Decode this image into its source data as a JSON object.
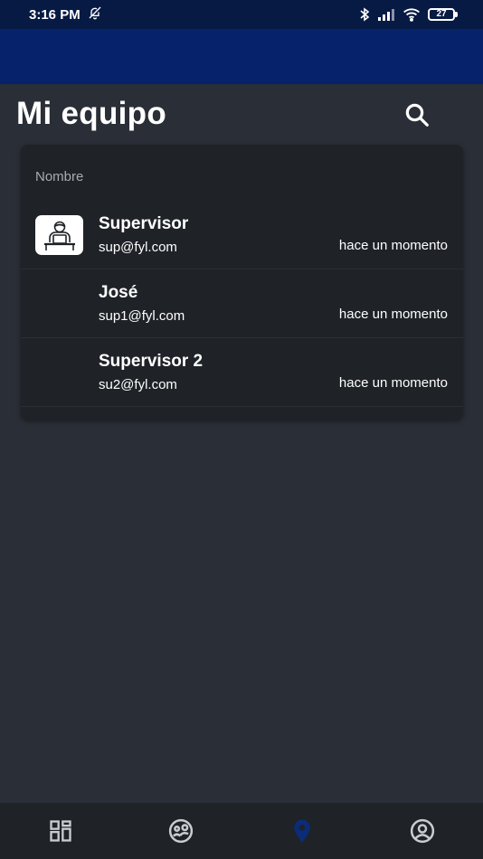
{
  "status_bar": {
    "time": "3:16 PM",
    "battery": "27"
  },
  "header": {
    "title": "Mi equipo"
  },
  "table": {
    "column_name": "Nombre",
    "rows": [
      {
        "name": "Supervisor",
        "email": "sup@fyl.com",
        "time": "hace un momento",
        "has_avatar": true
      },
      {
        "name": "José",
        "email": "sup1@fyl.com",
        "time": "hace un momento",
        "has_avatar": false
      },
      {
        "name": "Supervisor 2",
        "email": "su2@fyl.com",
        "time": "hace un momento",
        "has_avatar": false
      }
    ]
  },
  "bottom_nav": {
    "items": [
      {
        "icon": "dashboard-icon"
      },
      {
        "icon": "team-icon"
      },
      {
        "icon": "location-pin-icon",
        "active": true
      },
      {
        "icon": "account-icon"
      }
    ]
  },
  "colors": {
    "status_bar": "#061a44",
    "app_bar": "#05226a",
    "background": "#2a2e36",
    "card": "#1f2227",
    "active_nav": "#0b2c78"
  }
}
